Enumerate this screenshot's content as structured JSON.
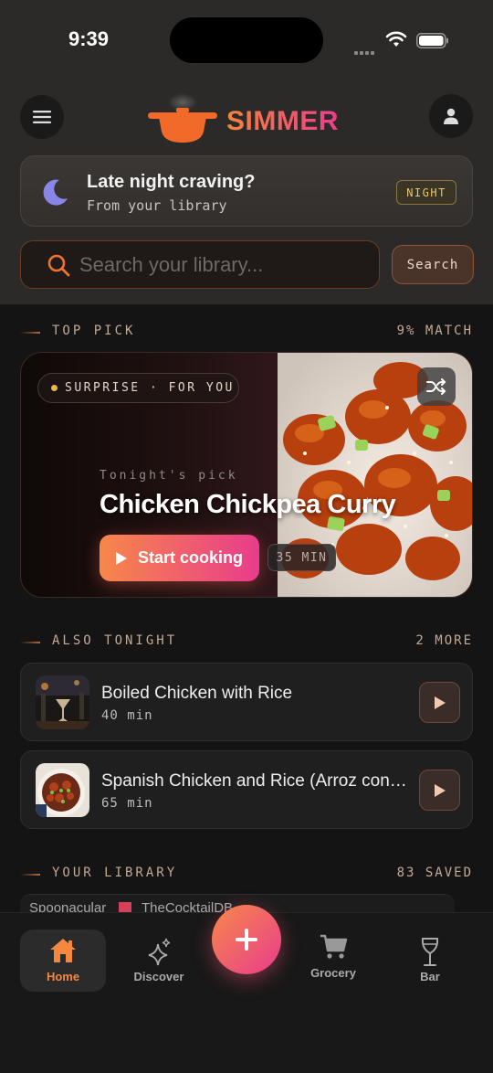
{
  "status_bar": {
    "time": "9:39"
  },
  "header": {
    "app_name": "SIMMER",
    "menu_icon": "hamburger-icon",
    "profile_icon": "person-icon"
  },
  "banner": {
    "title": "Late night craving?",
    "subtitle": "From your library",
    "badge": "NIGHT",
    "icon": "moon-icon"
  },
  "search": {
    "placeholder": "Search your library...",
    "value": "",
    "button_label": "Search"
  },
  "top_pick": {
    "section_title": "TOP PICK",
    "match": "9% MATCH",
    "pill": "SURPRISE · FOR YOU",
    "tagline": "Tonight's pick",
    "recipe_title": "Chicken Chickpea Curry",
    "start_label": "Start cooking",
    "duration": "35 MIN"
  },
  "also_tonight": {
    "section_title": "ALSO TONIGHT",
    "count": "2 MORE",
    "items": [
      {
        "title": "Boiled Chicken with Rice",
        "time": "40 min"
      },
      {
        "title": "Spanish Chicken and Rice (Arroz con Pollo)",
        "time": "65 min"
      }
    ]
  },
  "library": {
    "section_title": "YOUR LIBRARY",
    "count": "83 SAVED",
    "sources": [
      "Spoonacular",
      "TheCocktailDB"
    ]
  },
  "nav": {
    "items": [
      {
        "label": "Home",
        "icon": "home-icon",
        "active": true
      },
      {
        "label": "Discover",
        "icon": "sparkle-icon",
        "active": false
      },
      {
        "label": "Grocery",
        "icon": "cart-icon",
        "active": false
      },
      {
        "label": "Bar",
        "icon": "wine-glass-icon",
        "active": false
      }
    ],
    "add_icon": "plus-icon"
  },
  "colors": {
    "accent_orange": "#f6843c",
    "accent_pink": "#ea3d8f",
    "night_badge": "#e8c66a"
  }
}
